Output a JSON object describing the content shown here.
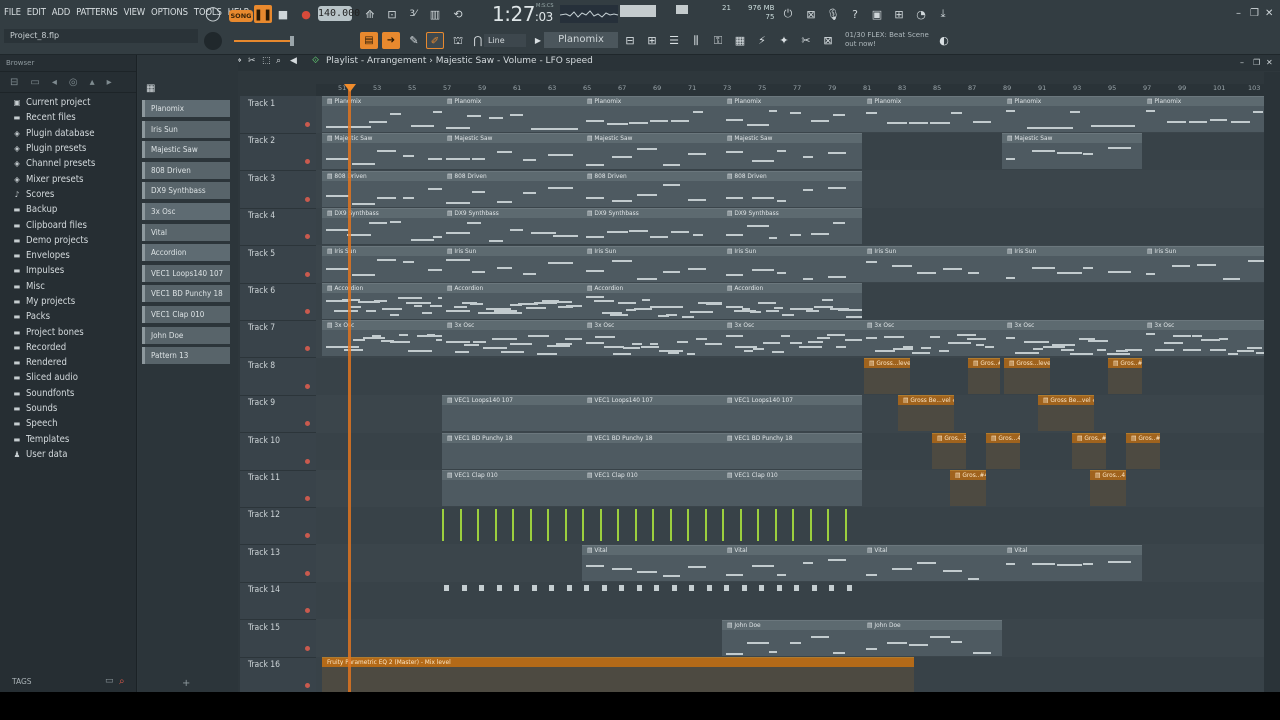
{
  "menu": [
    "FILE",
    "EDIT",
    "ADD",
    "PATTERNS",
    "VIEW",
    "OPTIONS",
    "TOOLS",
    "HELP"
  ],
  "transport": {
    "song_label": "SONG",
    "tempo": "140.000",
    "time": "1:27",
    "time_frac": ":03",
    "time_sub": "M:S:CS"
  },
  "monitor": {
    "cpu": "21",
    "memory": "976 MB",
    "voices": "75"
  },
  "project": {
    "name": "Project_8.flp"
  },
  "toolbar2": {
    "snap": "Line",
    "pattern": "Planomix",
    "hint_line1": "01/30 FLEX: Beat Scene",
    "hint_line2": "out now!"
  },
  "browser": {
    "title": "Browser",
    "items": [
      {
        "label": "Current project",
        "icon": "doc-icon"
      },
      {
        "label": "Recent files",
        "icon": "folder-icon"
      },
      {
        "label": "Plugin database",
        "icon": "plugin-icon"
      },
      {
        "label": "Plugin presets",
        "icon": "plugin-icon"
      },
      {
        "label": "Channel presets",
        "icon": "plugin-icon"
      },
      {
        "label": "Mixer presets",
        "icon": "plugin-icon"
      },
      {
        "label": "Scores",
        "icon": "note-icon"
      },
      {
        "label": "Backup",
        "icon": "folder-icon"
      },
      {
        "label": "Clipboard files",
        "icon": "folder-icon"
      },
      {
        "label": "Demo projects",
        "icon": "folder-icon"
      },
      {
        "label": "Envelopes",
        "icon": "folder-icon"
      },
      {
        "label": "Impulses",
        "icon": "folder-icon"
      },
      {
        "label": "Misc",
        "icon": "folder-icon"
      },
      {
        "label": "My projects",
        "icon": "folder-icon"
      },
      {
        "label": "Packs",
        "icon": "folder-icon"
      },
      {
        "label": "Project bones",
        "icon": "folder-icon"
      },
      {
        "label": "Recorded",
        "icon": "folder-icon"
      },
      {
        "label": "Rendered",
        "icon": "folder-icon"
      },
      {
        "label": "Sliced audio",
        "icon": "folder-icon"
      },
      {
        "label": "Soundfonts",
        "icon": "folder-icon"
      },
      {
        "label": "Sounds",
        "icon": "folder-icon"
      },
      {
        "label": "Speech",
        "icon": "folder-icon"
      },
      {
        "label": "Templates",
        "icon": "folder-icon"
      },
      {
        "label": "User data",
        "icon": "user-icon"
      }
    ],
    "tags_label": "TAGS"
  },
  "playlist": {
    "title": "Playlist - Arrangement",
    "breadcrumb": "Majestic Saw - Volume - LFO speed",
    "bar_numbers": [
      "51",
      "53",
      "55",
      "57",
      "59",
      "61",
      "63",
      "65",
      "67",
      "69",
      "71",
      "73",
      "75",
      "77",
      "79",
      "81",
      "83",
      "85",
      "87",
      "89",
      "91",
      "93",
      "95",
      "97",
      "99",
      "101",
      "103"
    ],
    "picker": [
      "Planomix",
      "Iris Sun",
      "Majestic Saw",
      "808 Driven",
      "DX9 Synthbass",
      "3x Osc",
      "Vital",
      "Accordion",
      "VEC1 Loops140 107",
      "VEC1 BD Punchy 18",
      "VEC1 Clap 010",
      "John Doe",
      "Pattern 13"
    ],
    "tracks": [
      "Track 1",
      "Track 2",
      "Track 3",
      "Track 4",
      "Track 5",
      "Track 6",
      "Track 7",
      "Track 8",
      "Track 9",
      "Track 10",
      "Track 11",
      "Track 12",
      "Track 13",
      "Track 14",
      "Track 15",
      "Track 16"
    ],
    "clip_names": {
      "t1": "Planomix",
      "t2": "Majestic Saw",
      "t3": "808 Driven",
      "t4": "DX9 Synthbass",
      "t5": "Iris Sun",
      "t6": "Accordion",
      "t7": "3x Osc",
      "t8a": "Gross...level",
      "t8b": "Gros..#3",
      "t9": "Gross Be...vel #2",
      "t9b": "VEC1 Loops140 107",
      "t10a": "Gros...3",
      "t10b": "Gros...4",
      "t10c": "Gros..#3",
      "t10d": "Gros..#4",
      "t10e": "VEC1 BD Punchy 18",
      "t11a": "Gros..#4",
      "t11b": "Gros...4",
      "t11c": "VEC1 Clap 010",
      "t13": "Vital",
      "t15": "John Doe",
      "t16": "Fruity Parametric EQ 2 (Master) - Mix level"
    }
  },
  "colors": {
    "accent": "#e8892e",
    "playhead": "#e07420",
    "clip": "#4e5a61",
    "automation": "#a0631d"
  }
}
